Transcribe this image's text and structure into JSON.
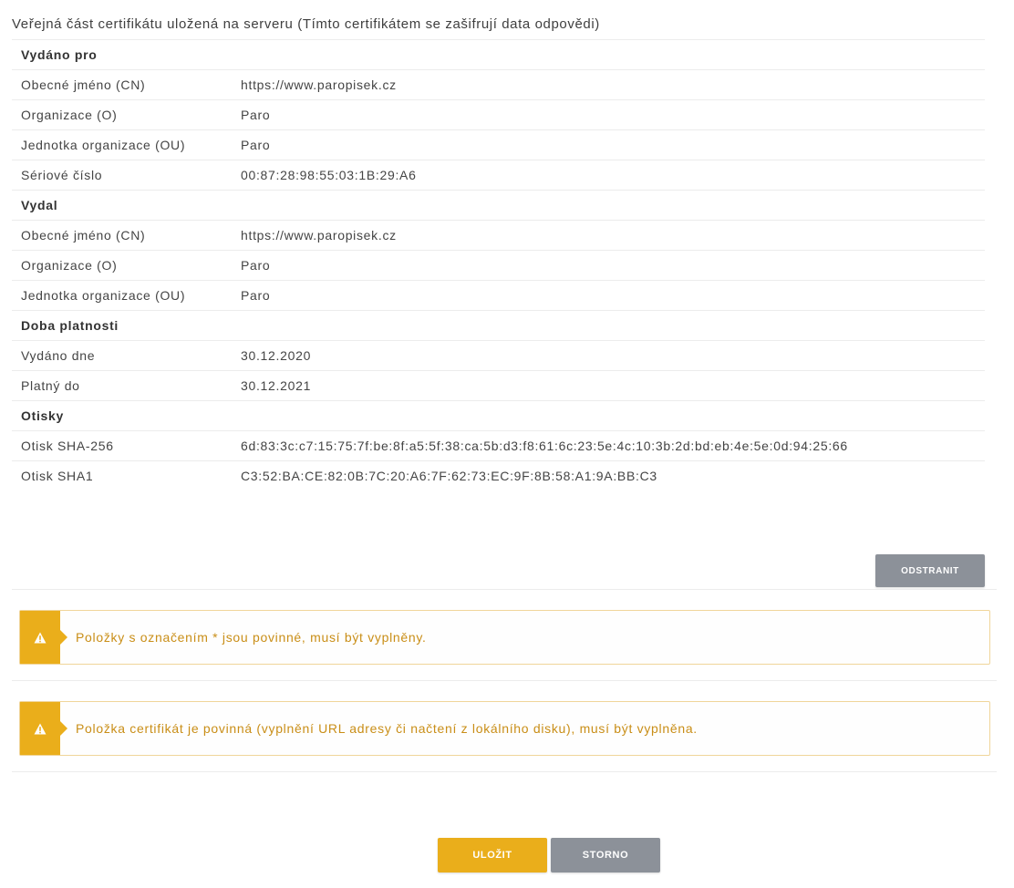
{
  "header": {
    "title": "Veřejná část certifikátu uložená na serveru (Tímto certifikátem se zašifrují data odpovědi)"
  },
  "sections": [
    {
      "title": "Vydáno pro",
      "rows": [
        {
          "label": "Obecné jméno (CN)",
          "value": "https://www.paropisek.cz"
        },
        {
          "label": "Organizace (O)",
          "value": "Paro"
        },
        {
          "label": "Jednotka organizace (OU)",
          "value": "Paro"
        },
        {
          "label": "Sériové číslo",
          "value": "00:87:28:98:55:03:1B:29:A6"
        }
      ]
    },
    {
      "title": "Vydal",
      "rows": [
        {
          "label": "Obecné jméno (CN)",
          "value": "https://www.paropisek.cz"
        },
        {
          "label": "Organizace (O)",
          "value": "Paro"
        },
        {
          "label": "Jednotka organizace (OU)",
          "value": "Paro"
        }
      ]
    },
    {
      "title": "Doba platnosti",
      "rows": [
        {
          "label": "Vydáno dne",
          "value": "30.12.2020"
        },
        {
          "label": "Platný do",
          "value": "30.12.2021"
        }
      ]
    },
    {
      "title": "Otisky",
      "rows": [
        {
          "label": "Otisk SHA-256",
          "value": "6d:83:3c:c7:15:75:7f:be:8f:a5:5f:38:ca:5b:d3:f8:61:6c:23:5e:4c:10:3b:2d:bd:eb:4e:5e:0d:94:25:66"
        },
        {
          "label": "Otisk SHA1",
          "value": "C3:52:BA:CE:82:0B:7C:20:A6:7F:62:73:EC:9F:8B:58:A1:9A:BB:C3"
        }
      ]
    }
  ],
  "buttons": {
    "remove": "ODSTRANIT",
    "save": "ULOŽIT",
    "cancel": "STORNO"
  },
  "alerts": [
    {
      "icon": "warning-icon",
      "text": "Položky s označením * jsou povinné, musí být vyplněny."
    },
    {
      "icon": "warning-icon",
      "text": "Položka certifikát je povinná (vyplnění URL adresy či načtení z lokálního disku), musí být vyplněna."
    }
  ],
  "colors": {
    "accent": "#eaae1b",
    "secondary": "#8c9199",
    "alert_text": "#c98e17"
  }
}
